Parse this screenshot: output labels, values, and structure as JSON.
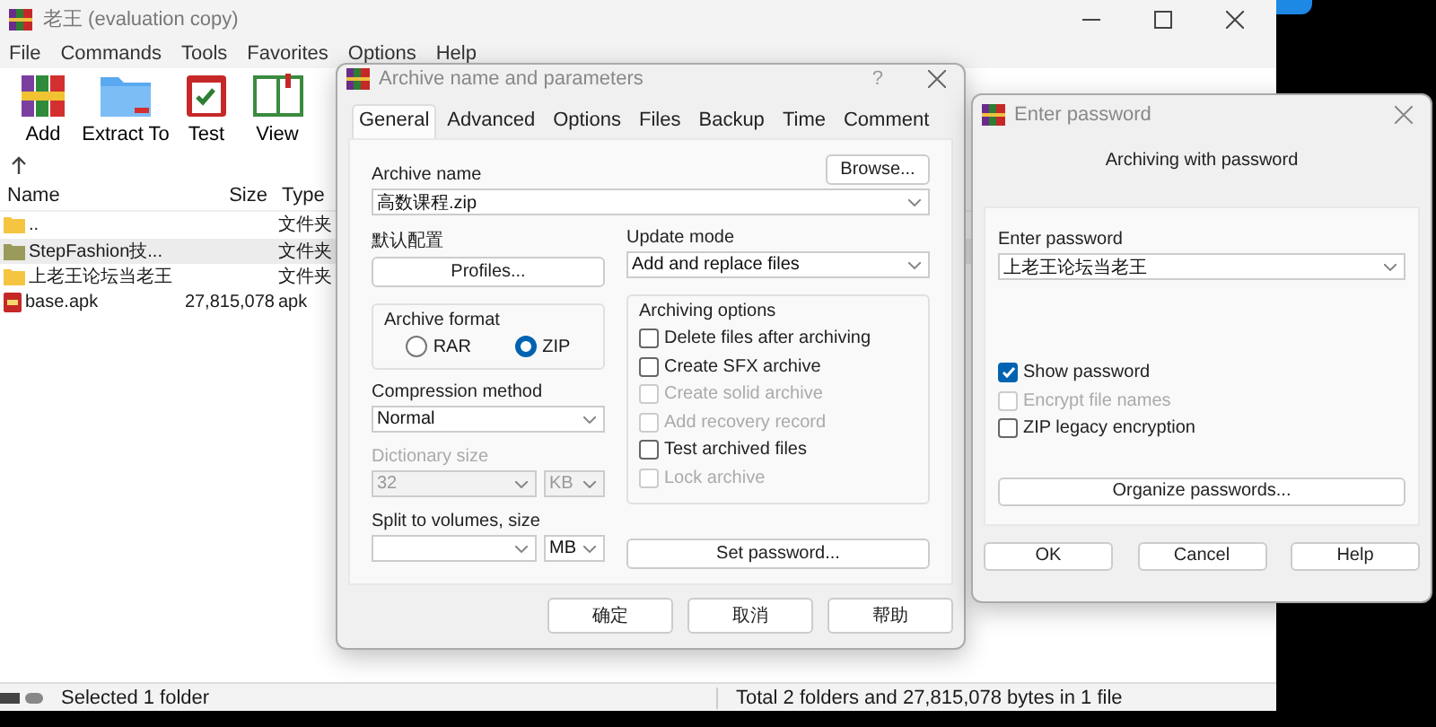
{
  "main_window": {
    "title": "老王 (evaluation copy)",
    "menu": [
      "File",
      "Commands",
      "Tools",
      "Favorites",
      "Options",
      "Help"
    ],
    "toolbar": [
      {
        "label": "Add",
        "kind": "add"
      },
      {
        "label": "Extract To",
        "kind": "extract"
      },
      {
        "label": "Test",
        "kind": "test"
      },
      {
        "label": "View",
        "kind": "view"
      }
    ],
    "columns": [
      "Name",
      "Size",
      "Type"
    ],
    "rows": [
      {
        "name": "..",
        "type": "文件夹",
        "kind": "folder",
        "selected": false
      },
      {
        "name": "StepFashion技...",
        "type": "文件夹",
        "kind": "folder-green",
        "selected": true
      },
      {
        "name": "上老王论坛当老王",
        "type": "文件夹",
        "kind": "folder",
        "selected": false
      },
      {
        "name": "base.apk",
        "size": "27,815,078",
        "type": "apk",
        "kind": "file",
        "selected": false
      }
    ],
    "status_left": "Selected 1 folder",
    "status_right": "Total 2 folders and 27,815,078 bytes in 1 file"
  },
  "archive_dialog": {
    "title": "Archive name and parameters",
    "help": "?",
    "tabs": [
      {
        "label": "General",
        "selected": true
      },
      {
        "label": "Advanced",
        "selected": false
      },
      {
        "label": "Options",
        "selected": false
      },
      {
        "label": "Files",
        "selected": false
      },
      {
        "label": "Backup",
        "selected": false
      },
      {
        "label": "Time",
        "selected": false
      },
      {
        "label": "Comment",
        "selected": false
      }
    ],
    "archive_name_label": "Archive name",
    "browse": "Browse...",
    "archive_name": "高数课程.zip",
    "profile_label": "默认配置",
    "profiles": "Profiles...",
    "update_mode_label": "Update mode",
    "update_mode": "Add and replace files",
    "format_label": "Archive format",
    "formats": [
      {
        "label": "RAR",
        "selected": false
      },
      {
        "label": "ZIP",
        "selected": true
      }
    ],
    "compression_label": "Compression method",
    "compression": "Normal",
    "dictionary": {
      "label": "Dictionary size",
      "value": "32",
      "unit": "KB",
      "disabled": true
    },
    "split_label": "Split to volumes, size",
    "split_unit": "MB",
    "options_label": "Archiving options",
    "options": [
      {
        "label": "Delete files after archiving",
        "checked": false,
        "disabled": false
      },
      {
        "label": "Create SFX archive",
        "checked": false,
        "disabled": false
      },
      {
        "label": "Create solid archive",
        "checked": false,
        "disabled": true
      },
      {
        "label": "Add recovery record",
        "checked": false,
        "disabled": true
      },
      {
        "label": "Test archived files",
        "checked": false,
        "disabled": false
      },
      {
        "label": "Lock archive",
        "checked": false,
        "disabled": true
      }
    ],
    "set_password": "Set password...",
    "buttons": [
      "确定",
      "取消",
      "帮助"
    ]
  },
  "password_dialog": {
    "title": "Enter password",
    "heading": "Archiving with password",
    "field_label": "Enter password",
    "password": "上老王论坛当老王",
    "options": [
      {
        "label": "Show password",
        "checked": true,
        "disabled": false
      },
      {
        "label": "Encrypt file names",
        "checked": false,
        "disabled": true
      },
      {
        "label": "ZIP legacy encryption",
        "checked": false,
        "disabled": false
      }
    ],
    "organize": "Organize passwords...",
    "buttons": [
      "OK",
      "Cancel",
      "Help"
    ]
  }
}
